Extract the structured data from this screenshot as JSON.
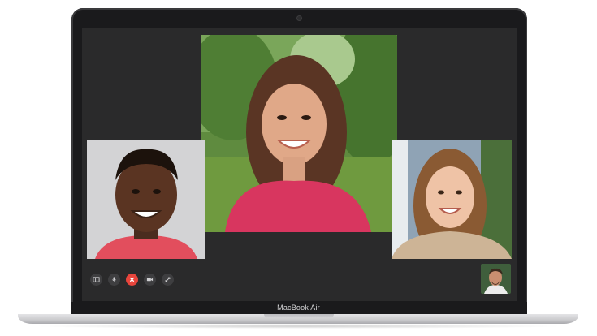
{
  "device": {
    "label": "MacBook Air"
  },
  "call": {
    "participants": [
      {
        "role": "main",
        "name": ""
      },
      {
        "role": "left",
        "name": ""
      },
      {
        "role": "right",
        "name": ""
      },
      {
        "role": "self",
        "name": ""
      }
    ],
    "controls": [
      {
        "id": "sidebar",
        "icon": "sidebar-icon"
      },
      {
        "id": "mute",
        "icon": "microphone-icon"
      },
      {
        "id": "end",
        "icon": "end-call-icon"
      },
      {
        "id": "camera",
        "icon": "video-camera-icon"
      },
      {
        "id": "fullscreen",
        "icon": "fullscreen-icon"
      }
    ],
    "colors": {
      "end_call": "#e8453c",
      "screen_bg": "#2a2a2b",
      "control_bg": "#3e3e40"
    }
  }
}
